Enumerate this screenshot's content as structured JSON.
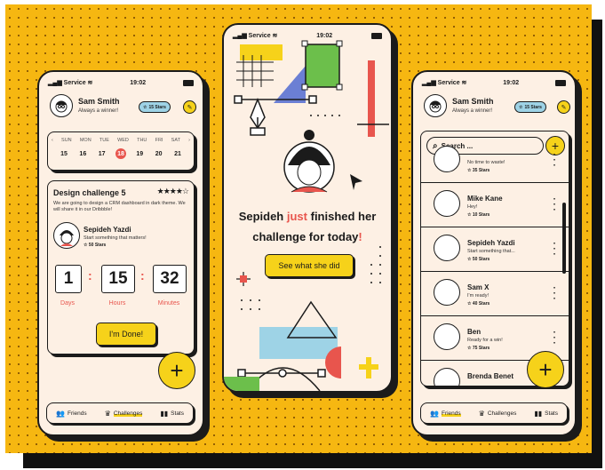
{
  "colors": {
    "background": "#f6b711",
    "card": "#fdf0e4",
    "accent_yellow": "#f6d21a",
    "accent_red": "#e8554d",
    "accent_blue": "#9ed3e6",
    "accent_green": "#6cbf4b"
  },
  "status_bar": {
    "carrier": "Service",
    "time": "19:02"
  },
  "left_phone": {
    "user_name": "Sam Smith",
    "user_tagline": "Always a winner!",
    "stars_badge": "15 Stars",
    "calendar": {
      "weekdays": [
        "SUN",
        "MON",
        "TUE",
        "WED",
        "THU",
        "FRI",
        "SAT"
      ],
      "dates": [
        "15",
        "16",
        "17",
        "18",
        "19",
        "20",
        "21"
      ],
      "selected_index": 3
    },
    "challenge": {
      "title": "Design challenge 5",
      "rating": "★★★★☆",
      "description": "We are going to design a CRM dashboard in dark theme. We will share it in our Dribbble!",
      "author_name": "Sepideh Yazdi",
      "author_msg": "Start something that matters!",
      "author_stars": "50 Stars",
      "timer": {
        "days": "1",
        "hours": "15",
        "minutes": "32",
        "days_label": "Days",
        "hours_label": "Hours",
        "minutes_label": "Minutes"
      },
      "done_button": "I'm Done!"
    },
    "fab": "+",
    "tabs": [
      "Friends",
      "Challenges",
      "Stats"
    ]
  },
  "middle_phone": {
    "message_before": "Sepideh ",
    "message_highlight": "just",
    "message_after": " finished her",
    "message_line2": "challenge for today",
    "message_mark": "!",
    "cta_button": "See what she did"
  },
  "right_phone": {
    "user_name": "Sam Smith",
    "user_tagline": "Always a winner!",
    "stars_badge": "15 Stars",
    "search_placeholder": "Search ...",
    "add_button": "+",
    "friends": [
      {
        "name": "",
        "message": "No time to waste!",
        "stars": "35 Stars"
      },
      {
        "name": "Mike Kane",
        "message": "Hey!",
        "stars": "10 Stars"
      },
      {
        "name": "Sepideh Yazdi",
        "message": "Start something that...",
        "stars": "50 Stars"
      },
      {
        "name": "Sam X",
        "message": "I'm ready!",
        "stars": "40 Stars"
      },
      {
        "name": "Ben",
        "message": "Ready for a win!",
        "stars": "75 Stars"
      },
      {
        "name": "Brenda Benet",
        "message": "",
        "stars": ""
      }
    ],
    "fab": "+",
    "tabs": [
      "Friends",
      "Challenges",
      "Stats"
    ]
  }
}
